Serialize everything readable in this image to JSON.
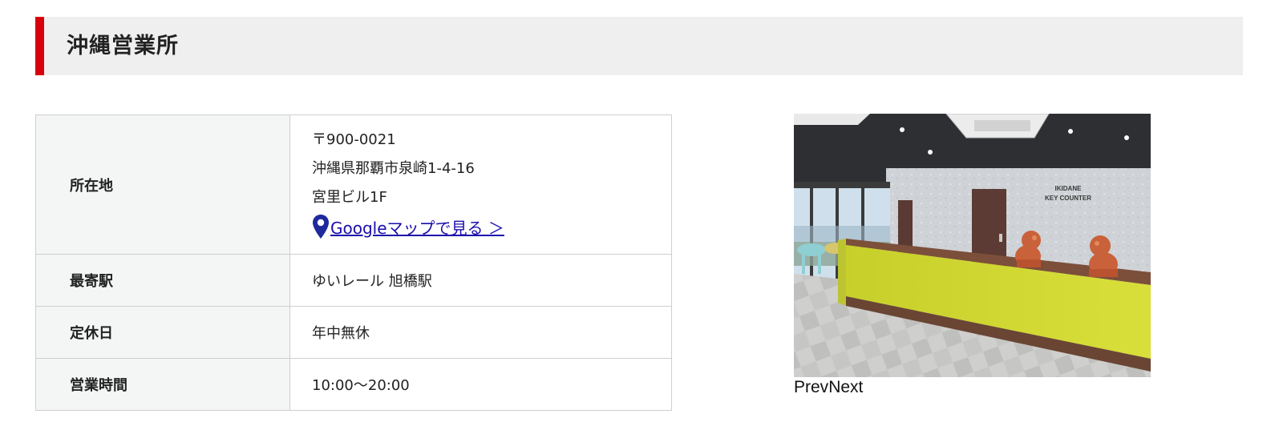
{
  "office": {
    "title": "沖縄営業所",
    "accent_color": "#d9000d"
  },
  "info_table": {
    "address_label": "所在地",
    "postal_code": "〒900-0021",
    "address_line1": "沖縄県那覇市泉崎1-4-16",
    "address_line2": "宮里ビル1F",
    "map_link_text": "Googleマップで見る ＞",
    "map_icon": "map-pin-icon",
    "station_label": "最寄駅",
    "station_value": "ゆいレール 旭橋駅",
    "holiday_label": "定休日",
    "holiday_value": "年中無休",
    "hours_label": "営業時間",
    "hours_value": "10:00〜20:00"
  },
  "slider": {
    "photo_text_line1": "IKIDANE",
    "photo_text_line2": "KEY COUNTER",
    "prev_label": "Prev",
    "next_label": "Next"
  }
}
